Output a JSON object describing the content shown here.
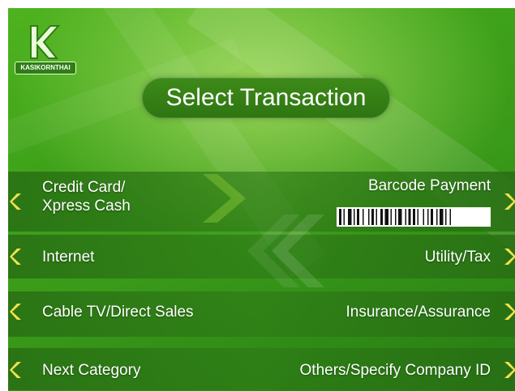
{
  "bank": {
    "logo_text": "KASIKORNTHAI"
  },
  "title": "Select Transaction",
  "left_options": [
    {
      "label_line1": "Credit Card/",
      "label_line2": "Xpress Cash"
    },
    {
      "label": "Internet"
    },
    {
      "label": "Cable TV/Direct Sales"
    },
    {
      "label": "Next Category"
    }
  ],
  "right_options": [
    {
      "label": "Barcode Payment"
    },
    {
      "label": "Utility/Tax"
    },
    {
      "label": "Insurance/Assurance"
    },
    {
      "label": "Others/Specify Company ID"
    }
  ],
  "colors": {
    "background": "#3a9a19",
    "arrow": "#f2e24a",
    "text": "#ffffff"
  },
  "icons": {
    "left_arrow": "chevron-left-icon",
    "right_arrow": "chevron-right-icon",
    "barcode": "barcode-icon",
    "logo": "kasikorn-k-logo-icon"
  }
}
